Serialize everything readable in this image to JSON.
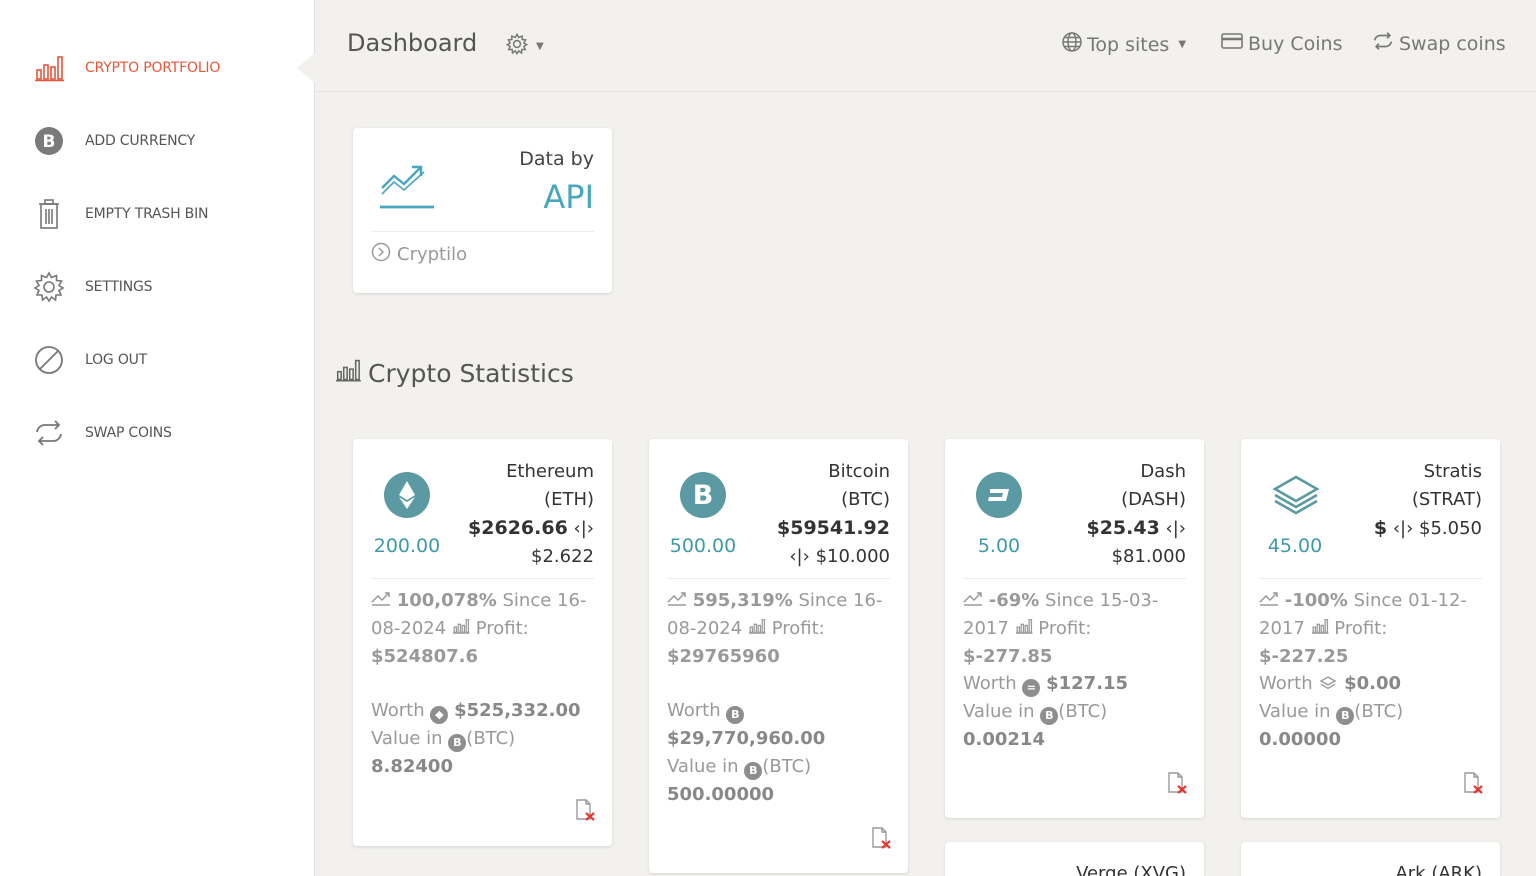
{
  "sidebar": {
    "items": [
      {
        "label": "CRYPTO PORTFOLIO",
        "icon": "bar-chart-icon",
        "active": true
      },
      {
        "label": "ADD CURRENCY",
        "icon": "bitcoin-icon"
      },
      {
        "label": "EMPTY TRASH BIN",
        "icon": "trash-icon"
      },
      {
        "label": "SETTINGS",
        "icon": "gear-icon"
      },
      {
        "label": "LOG OUT",
        "icon": "ban-icon"
      },
      {
        "label": "SWAP COINS",
        "icon": "swap-icon"
      }
    ]
  },
  "header": {
    "title": "Dashboard",
    "links": [
      {
        "label": "Top sites",
        "icon": "globe-icon"
      },
      {
        "label": "Buy Coins",
        "icon": "credit-card-icon"
      },
      {
        "label": "Swap coins",
        "icon": "swap-icon"
      }
    ]
  },
  "api_card": {
    "data_by": "Data by",
    "api": "API",
    "footer": "Cryptilo"
  },
  "section": {
    "title": "Crypto Statistics"
  },
  "coins": [
    {
      "name": "Ethereum",
      "symbol": "(ETH)",
      "price": "$2626.66",
      "ref_price": "$2.622",
      "quantity": "200.00",
      "change": "100,078%",
      "since_label": "Since",
      "since": "16-08-2024",
      "profit_label": "Profit:",
      "profit": "$524807.6",
      "worth_label": "Worth",
      "worth": "$525,332.00",
      "value_label": "Value in",
      "value_unit": "(BTC)",
      "value": "8.82400"
    },
    {
      "name": "Bitcoin",
      "symbol": "(BTC)",
      "price": "$59541.92",
      "ref_price": "$10.000",
      "quantity": "500.00",
      "change": "595,319%",
      "since_label": "Since",
      "since": "16-08-2024",
      "profit_label": "Profit:",
      "profit": "$29765960",
      "worth_label": "Worth",
      "worth": "$29,770,960.00",
      "value_label": "Value in",
      "value_unit": "(BTC)",
      "value": "500.00000"
    },
    {
      "name": "Dash",
      "symbol": "(DASH)",
      "price": "$25.43",
      "ref_price": "$81.000",
      "quantity": "5.00",
      "change": "-69%",
      "since_label": "Since",
      "since": "15-03-2017",
      "profit_label": "Profit:",
      "profit": "$-277.85",
      "worth_label": "Worth",
      "worth": "$127.15",
      "value_label": "Value in",
      "value_unit": "(BTC)",
      "value": "0.00214"
    },
    {
      "name": "Stratis",
      "symbol": "(STRAT)",
      "price": "$",
      "ref_price": "$5.050",
      "quantity": "45.00",
      "change": "-100%",
      "since_label": "Since",
      "since": "01-12-2017",
      "profit_label": "Profit:",
      "profit": "$-227.25",
      "worth_label": "Worth",
      "worth": "$0.00",
      "value_label": "Value in",
      "value_unit": "(BTC)",
      "value": "0.00000"
    }
  ],
  "partial_coins": [
    {
      "name": "Verge (XVG)"
    },
    {
      "name": "Ark (ARK)"
    }
  ],
  "colors": {
    "accent": "#e8573a",
    "teal": "#47a7bf",
    "qty": "#3f9aa8",
    "delete": "#e53935"
  }
}
